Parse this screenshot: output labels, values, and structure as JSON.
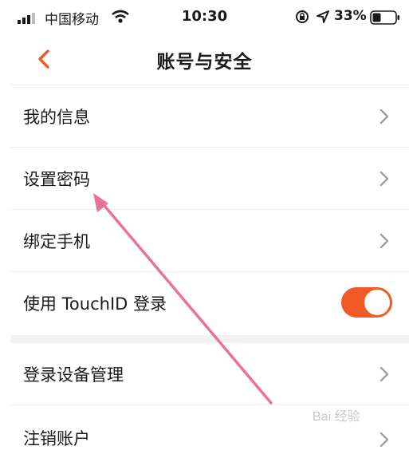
{
  "status_bar": {
    "carrier": "中国移动",
    "time": "10:30",
    "battery_percent": "33%"
  },
  "nav": {
    "title": "账号与安全"
  },
  "settings": {
    "my_info": "我的信息",
    "set_password": "设置密码",
    "bind_phone": "绑定手机",
    "touchid_login": "使用 TouchID 登录",
    "touchid_enabled": true,
    "device_management": "登录设备管理",
    "deactivate_account": "注销账户"
  },
  "colors": {
    "accent": "#f15a24",
    "annotation_arrow": "#e8739a"
  },
  "watermark": "Bai 经验"
}
